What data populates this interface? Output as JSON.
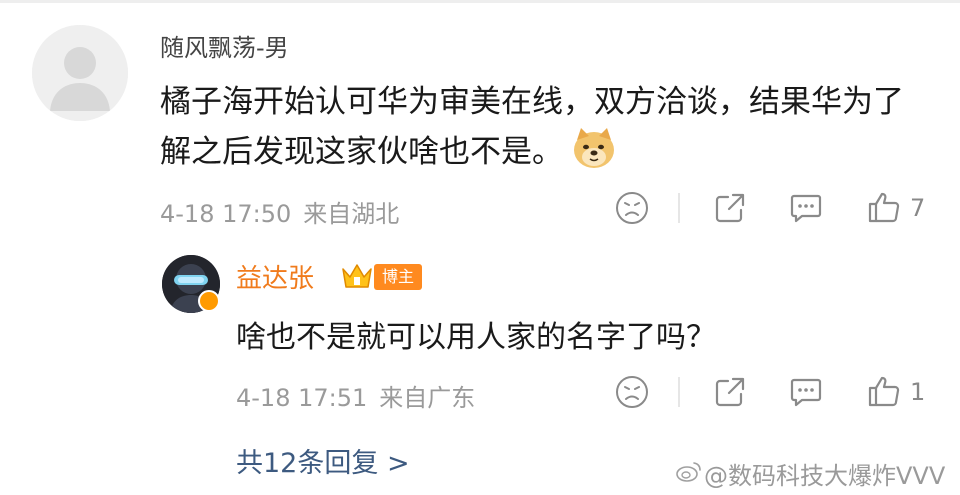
{
  "comment": {
    "username": "随风飘荡-男",
    "text": "橘子海开始认可华为审美在线，双方洽谈，结果华为了解之后发现这家伙啥也不是。",
    "emoji": "doge-emoji",
    "date": "4-18 17:50",
    "location": "来自湖北",
    "like_count": "7"
  },
  "reply": {
    "username": "益达张",
    "badge": "博主",
    "text": "啥也不是就可以用人家的名字了吗？",
    "date": "4-18 17:51",
    "location": "来自广东",
    "like_count": "1"
  },
  "more_replies": "共12条回复 >",
  "watermark": "@数码科技大爆炸VVV",
  "colors": {
    "reply_username": "#f07b1c",
    "blogger_badge": "#ff8a1f",
    "link": "#3d5a80",
    "meta_gray": "#9a9a9a"
  },
  "icons": [
    "dislike-face-icon",
    "share-icon",
    "comment-icon",
    "like-thumb-icon"
  ]
}
